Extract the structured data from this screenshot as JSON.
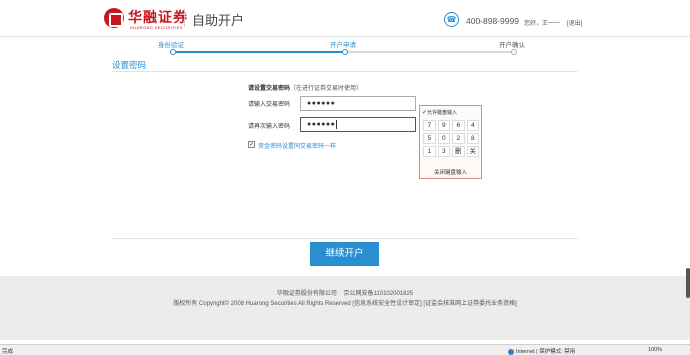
{
  "header": {
    "brand_cn": "华融证券",
    "brand_en": "HUARONG SECURITIES",
    "app_title": "自助开户",
    "hotline": "400-898-9999",
    "greeting": "您好，王一一",
    "logout": "[退出]"
  },
  "steps": [
    {
      "label": "身份验证",
      "state": "done"
    },
    {
      "label": "开户申请",
      "state": "done"
    },
    {
      "label": "开户确认",
      "state": "current"
    }
  ],
  "section_title": "设置密码",
  "form": {
    "heading": "请设置交易密码",
    "heading_hint": "（在进行证券交易时使用）",
    "password_label": "请输入交易密码",
    "password_value": "●●●●●●",
    "confirm_label": "请再次输入密码",
    "confirm_value": "●●●●●●",
    "sync_checkbox_mark": "✓",
    "sync_label": "资金密码设置同交易密码一样"
  },
  "keypad": {
    "head": "允许键盘输入",
    "keys": [
      "7",
      "9",
      "6",
      "4",
      "5",
      "0",
      "2",
      "8",
      "1",
      "3",
      "删",
      "关"
    ],
    "close": "关闭键盘输入"
  },
  "continue_button": "继续开户",
  "footer": {
    "company": "华融证券股份有限公司",
    "icp": "京公网安备110102001825",
    "copyright": "版权所有 Copyright© 2008 Huarong Securities All Rights Reserved [信息系统安全性设计审定] [证监会核准网上证券委托业务资格]"
  },
  "statusbar": {
    "left": "完成",
    "zone": "Internet | 保护模式: 禁用",
    "zoom": "100%"
  },
  "colors": {
    "brand": "#c8161d",
    "accent": "#2a8fd0"
  }
}
